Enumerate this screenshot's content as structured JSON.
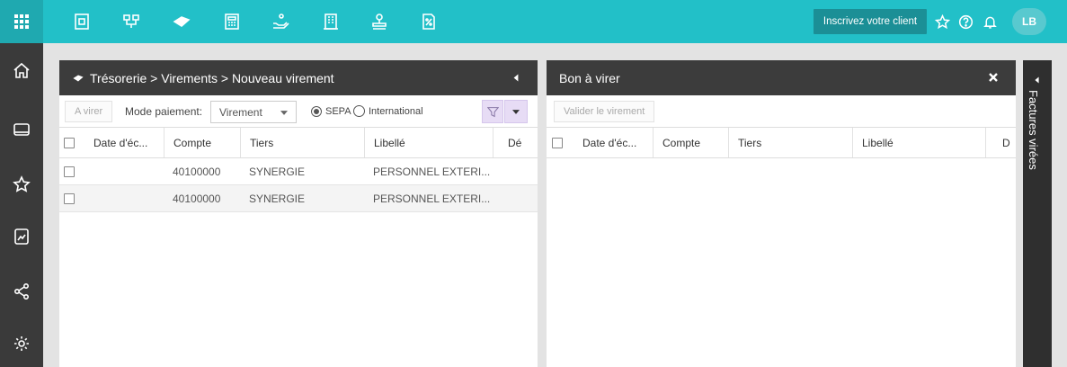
{
  "topbar": {
    "register_label": "Inscrivez votre client",
    "avatar_initials": "LB",
    "nav_icons": [
      "document-icon",
      "org-chart-icon",
      "money-icon",
      "calculator-icon",
      "hand-coin-icon",
      "building-icon",
      "stamp-icon",
      "percent-document-icon"
    ]
  },
  "sidebar": {
    "icons": [
      "home-icon",
      "screen-icon",
      "star-icon",
      "chart-document-icon",
      "share-icon",
      "settings-icon"
    ]
  },
  "left_panel": {
    "breadcrumb": "Trésorerie > Virements > Nouveau virement",
    "toolbar": {
      "avirer_label": "A virer",
      "mode_label": "Mode paiement:",
      "mode_value": "Virement",
      "sepa_label": "SEPA",
      "international_label": "International"
    },
    "columns": [
      "Date d'éc...",
      "Compte",
      "Tiers",
      "Libellé",
      "Dé"
    ],
    "rows": [
      {
        "date": "",
        "compte": "40100000",
        "tiers": "SYNERGIE",
        "libelle": "PERSONNEL EXTERI..."
      },
      {
        "date": "",
        "compte": "40100000",
        "tiers": "SYNERGIE",
        "libelle": "PERSONNEL EXTERI..."
      }
    ]
  },
  "right_panel": {
    "title": "Bon à virer",
    "validate_label": "Valider le virement",
    "columns": [
      "Date d'éc...",
      "Compte",
      "Tiers",
      "Libellé",
      "D"
    ]
  },
  "vertical_tab": {
    "label": "Factures virées"
  },
  "colors": {
    "topbar": "#22c0c8",
    "sidebar": "#3a3a3a",
    "header": "#3c3c3c",
    "filter_accent": "#e7dcf5"
  }
}
